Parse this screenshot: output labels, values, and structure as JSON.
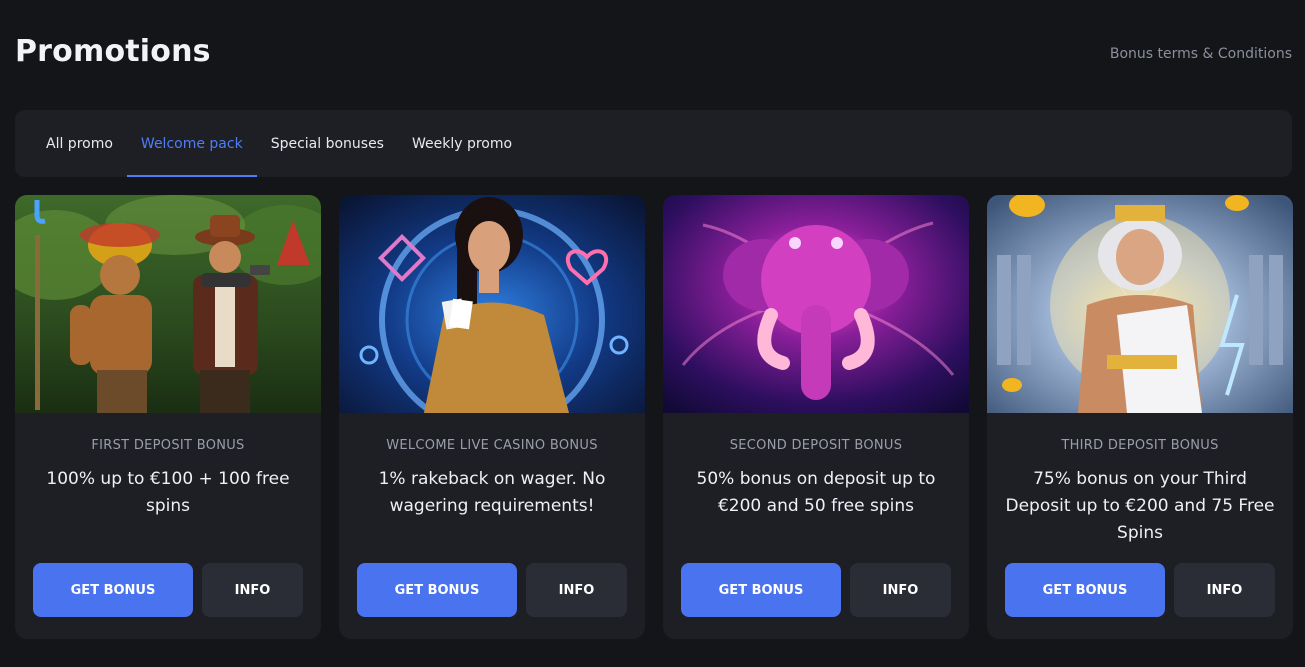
{
  "header": {
    "title": "Promotions",
    "terms_link": "Bonus terms & Conditions"
  },
  "tabs": [
    {
      "label": "All promo",
      "active": false
    },
    {
      "label": "Welcome pack",
      "active": true
    },
    {
      "label": "Special bonuses",
      "active": false
    },
    {
      "label": "Weekly promo",
      "active": false
    }
  ],
  "cards": [
    {
      "category": "FIRST DEPOSIT BONUS",
      "description": "100% up to €100 + 100 free spins",
      "get_label": "GET BONUS",
      "info_label": "INFO"
    },
    {
      "category": "WELCOME LIVE CASINO BONUS",
      "description": "1% rakeback on wager. No wagering requirements!",
      "get_label": "GET BONUS",
      "info_label": "INFO"
    },
    {
      "category": "SECOND DEPOSIT BONUS",
      "description": "50% bonus on deposit up to €200 and 50 free spins",
      "get_label": "GET BONUS",
      "info_label": "INFO"
    },
    {
      "category": "THIRD DEPOSIT BONUS",
      "description": "75% bonus on your Third Deposit up to €200 and 75 Free Spins",
      "get_label": "GET BONUS",
      "info_label": "INFO"
    }
  ],
  "colors": {
    "accent": "#4a73f0",
    "background": "#141519",
    "panel": "#1d1f25"
  }
}
